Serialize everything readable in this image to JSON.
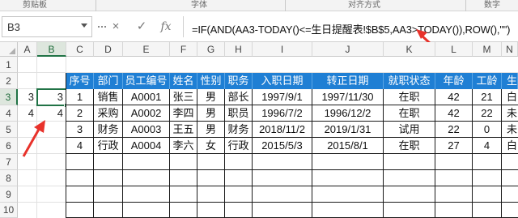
{
  "ribbon": {
    "groups": [
      "剪贴板",
      "字体",
      "对齐方式",
      "数字"
    ]
  },
  "formula_bar": {
    "name_box": "B3",
    "cancel_icon": "×",
    "enter_icon": "✓",
    "fx_label": "fx",
    "formula": "=IF(AND(AA3-TODAY()<=生日提醒表!$B$5,AA3>TODAY()),ROW(),\"\")"
  },
  "grid": {
    "columns": [
      "A",
      "B",
      "C",
      "D",
      "E",
      "F",
      "G",
      "H",
      "I",
      "J",
      "K",
      "L",
      "M",
      "N"
    ],
    "selected_column": "B",
    "rows": [
      "1",
      "2",
      "3",
      "4",
      "5",
      "6",
      "7",
      "8",
      "9",
      "10"
    ],
    "selected_row": "3",
    "col_a_values": [
      "3",
      "4"
    ],
    "col_b_values": [
      "3",
      "4"
    ]
  },
  "table": {
    "headers": [
      "序号",
      "部门",
      "员工编号",
      "姓名",
      "性别",
      "职务",
      "入职日期",
      "转正日期",
      "就职状态",
      "年龄",
      "工龄",
      "生"
    ],
    "rows": [
      [
        "1",
        "销售",
        "A0001",
        "张三",
        "男",
        "部长",
        "1997/9/1",
        "1997/11/30",
        "在职",
        "42",
        "21",
        "白"
      ],
      [
        "2",
        "采购",
        "A0002",
        "李四",
        "男",
        "职员",
        "1996/7/2",
        "1996/12/2",
        "在职",
        "42",
        "22",
        "未"
      ],
      [
        "3",
        "财务",
        "A0003",
        "王五",
        "男",
        "财务",
        "2018/11/2",
        "2019/1/31",
        "试用",
        "22",
        "0",
        "未"
      ],
      [
        "4",
        "行政",
        "A0004",
        "李六",
        "女",
        "行政",
        "2015/5/3",
        "2015/8/1",
        "在职",
        "27",
        "4",
        "白"
      ]
    ]
  },
  "colors": {
    "header_blue": "#1f7fd4",
    "selection_green": "#217346",
    "annotation_red": "#e8322b"
  },
  "icons": [
    "name-box-dropdown-icon",
    "cancel-icon",
    "enter-icon",
    "fx-icon",
    "annotation-arrow-icon"
  ]
}
